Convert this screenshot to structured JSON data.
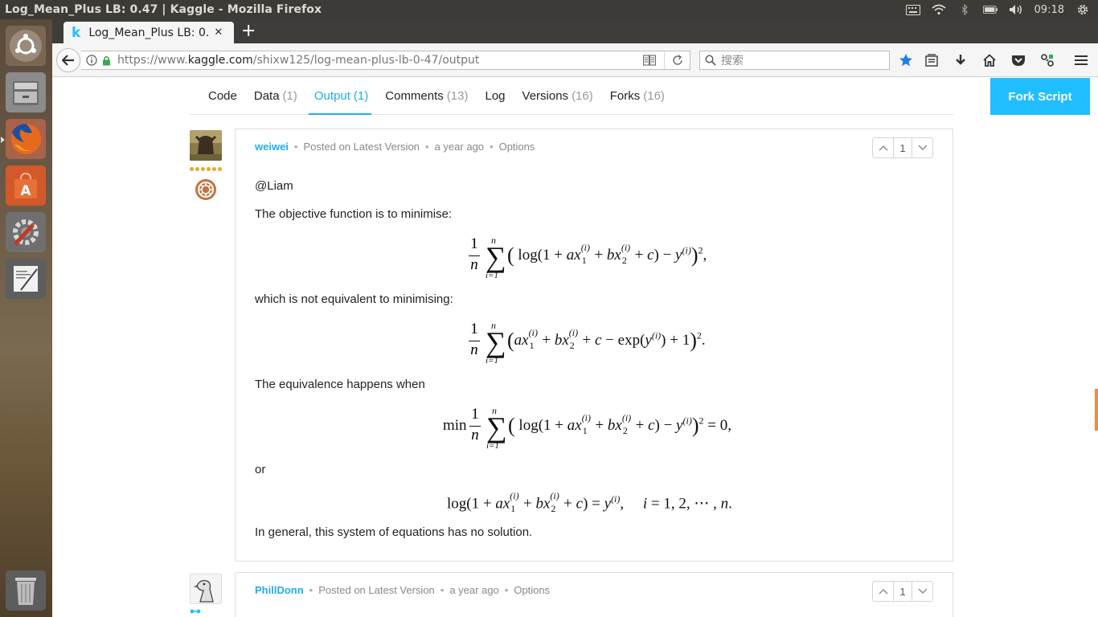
{
  "window": {
    "title": "Log_Mean_Plus LB: 0.47 | Kaggle - Mozilla Firefox",
    "clock": "09:18"
  },
  "browser": {
    "tab_title": "Log_Mean_Plus LB: 0.47",
    "url_scheme": "https://www.",
    "url_host": "kaggle.com",
    "url_path": "/shixw125/log-mean-plus-lb-0-47/output",
    "search_placeholder": "搜索"
  },
  "kernel_tabs": [
    {
      "label": "Code",
      "count": ""
    },
    {
      "label": "Data",
      "count": "(1)"
    },
    {
      "label": "Output",
      "count": "(1)",
      "active": true
    },
    {
      "label": "Comments",
      "count": "(13)"
    },
    {
      "label": "Log",
      "count": ""
    },
    {
      "label": "Versions",
      "count": "(16)"
    },
    {
      "label": "Forks",
      "count": "(16)"
    }
  ],
  "fork_button": "Fork Script",
  "comments": [
    {
      "author": "weiwei",
      "posted": "Posted on Latest Version",
      "time": "a year ago",
      "options": "Options",
      "votes": "1",
      "mention": "@Liam",
      "p1": "The objective function is to minimise:",
      "p2": "which is not equivalent to minimising:",
      "p3": "The equivalence happens when",
      "p4": "or",
      "p5": "In general, this system of equations has no solution.",
      "eq_min": "min",
      "eq_sum_top": "n",
      "eq_sum_bottom": "i=1",
      "eq_frac_num": "1",
      "eq_frac_den": "n"
    },
    {
      "author": "PhillDonn",
      "posted": "Posted on Latest Version",
      "time": "a year ago",
      "options": "Options",
      "votes": "1"
    }
  ],
  "colors": {
    "kaggle_blue": "#20beff",
    "tier_gold": "#e8a72f",
    "panel": "#3c3b37"
  }
}
